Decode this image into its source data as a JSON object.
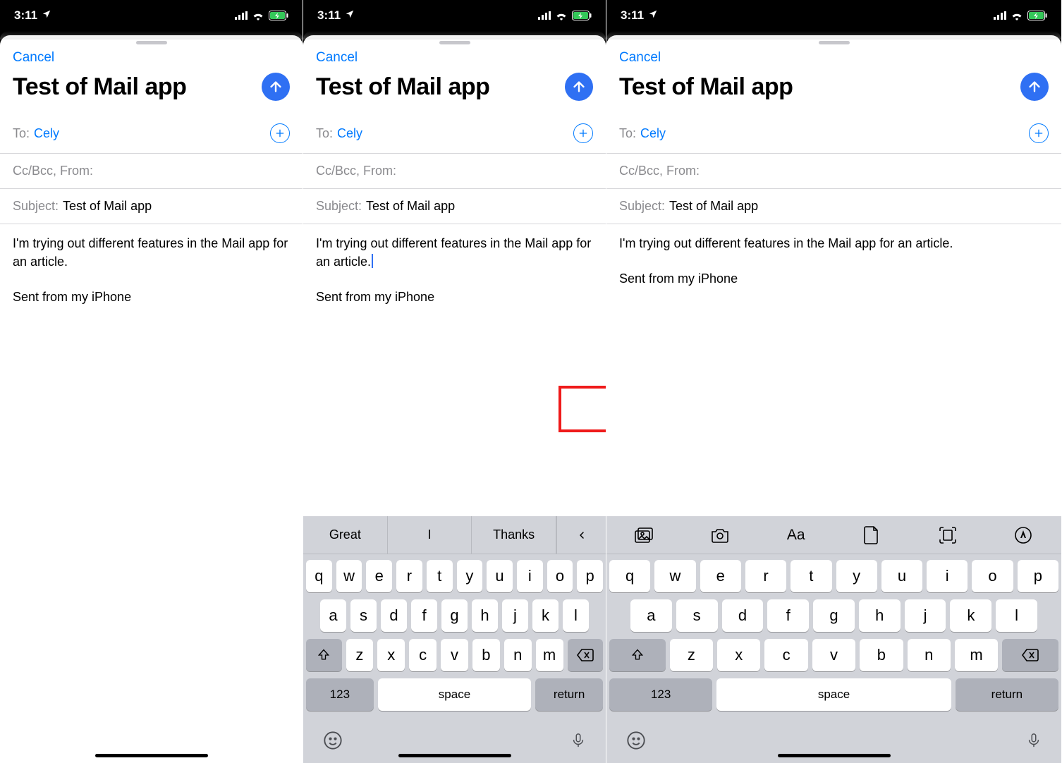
{
  "status": {
    "time": "3:11",
    "location_icon": "location-arrow",
    "signal": "signal-icon",
    "wifi": "wifi-icon",
    "battery": "battery-charging-icon"
  },
  "compose": {
    "cancel": "Cancel",
    "title": "Test of Mail app",
    "send_icon": "arrow-up",
    "to_label": "To:",
    "to_value": "Cely",
    "add_contact_icon": "plus",
    "ccbcc_label": "Cc/Bcc, From:",
    "subject_label": "Subject:",
    "subject_value": "Test of Mail app",
    "body": "I'm trying out different features in the Mail app for an article.",
    "signature": "Sent from my iPhone"
  },
  "keyboard": {
    "suggestions": [
      "Great",
      "I",
      "Thanks"
    ],
    "chevron_icon": "chevron-left",
    "toolbar": [
      {
        "name": "photo-library-icon"
      },
      {
        "name": "camera-icon"
      },
      {
        "name": "text-format-icon",
        "label": "Aa"
      },
      {
        "name": "document-icon"
      },
      {
        "name": "scan-icon"
      },
      {
        "name": "markup-icon"
      }
    ],
    "row1": [
      "q",
      "w",
      "e",
      "r",
      "t",
      "y",
      "u",
      "i",
      "o",
      "p"
    ],
    "row2": [
      "a",
      "s",
      "d",
      "f",
      "g",
      "h",
      "j",
      "k",
      "l"
    ],
    "row3": [
      "z",
      "x",
      "c",
      "v",
      "b",
      "n",
      "m"
    ],
    "shift": "shift-icon",
    "backspace": "backspace-icon",
    "numbers": "123",
    "space": "space",
    "return": "return",
    "emoji": "emoji-icon",
    "mic": "mic-icon"
  },
  "highlight": {
    "target": "chevron-collapse-button"
  }
}
